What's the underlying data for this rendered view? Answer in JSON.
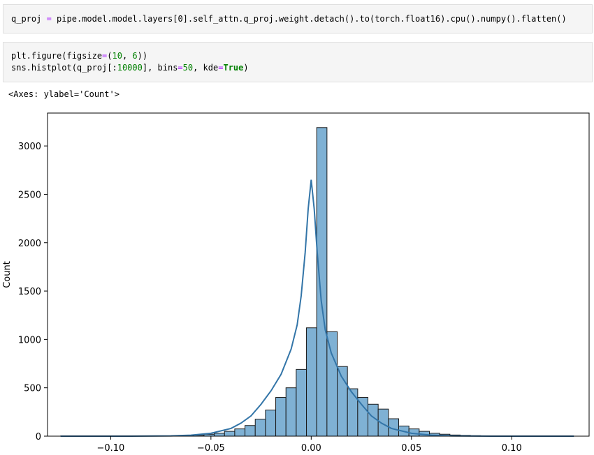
{
  "cells": {
    "code1": {
      "var": "q_proj",
      "eq": " = ",
      "text": "pipe.model.model.layers[0].self_attn.q_proj.weight.detach().to(torch.float16).cpu().numpy().flatten()"
    },
    "code2": {
      "line1_a": "plt.figure(figsize",
      "line1_eq": "=",
      "line1_b": "(",
      "line1_n1": "10",
      "line1_c": ", ",
      "line1_n2": "6",
      "line1_d": "))",
      "line2_a": "sns.histplot(q_proj[:",
      "line2_n1": "10000",
      "line2_b": "], bins",
      "line2_eq1": "=",
      "line2_n2": "50",
      "line2_c": ", kde",
      "line2_eq2": "=",
      "line2_kw": "True",
      "line2_d": ")"
    },
    "output_text": "<Axes: ylabel='Count'>"
  },
  "chart_data": {
    "type": "bar",
    "subtype": "histogram_with_kde",
    "title": "",
    "xlabel": "",
    "ylabel": "Count",
    "xlim": [
      -0.1315,
      0.1386
    ],
    "ylim": [
      0,
      3340
    ],
    "xticks": [
      -0.1,
      -0.05,
      0.0,
      0.05,
      0.1
    ],
    "xtick_labels": [
      "−0.10",
      "−0.05",
      "0.00",
      "0.05",
      "0.10"
    ],
    "yticks": [
      0,
      500,
      1000,
      1500,
      2000,
      2500,
      3000
    ],
    "ytick_labels": [
      "0",
      "500",
      "1000",
      "1500",
      "2000",
      "2500",
      "3000"
    ],
    "bins": 50,
    "bin_start": -0.125,
    "bin_width": 0.00511,
    "counts": [
      1,
      0,
      0,
      0,
      0,
      0,
      1,
      1,
      1,
      2,
      2,
      3,
      6,
      10,
      20,
      30,
      50,
      75,
      110,
      175,
      270,
      400,
      500,
      690,
      1120,
      3190,
      1080,
      720,
      490,
      400,
      330,
      280,
      180,
      105,
      75,
      50,
      30,
      20,
      12,
      8,
      5,
      3,
      2,
      1,
      1,
      0,
      0,
      0,
      0,
      1
    ],
    "kde_x": [
      -0.125,
      -0.09,
      -0.07,
      -0.06,
      -0.05,
      -0.04,
      -0.035,
      -0.03,
      -0.025,
      -0.02,
      -0.015,
      -0.01,
      -0.007,
      -0.005,
      -0.003,
      -0.0015,
      0,
      0.0015,
      0.003,
      0.005,
      0.007,
      0.01,
      0.015,
      0.02,
      0.025,
      0.03,
      0.035,
      0.04,
      0.05,
      0.06,
      0.07,
      0.09,
      0.131
    ],
    "kde_y": [
      0,
      0,
      3,
      10,
      30,
      80,
      135,
      210,
      330,
      470,
      640,
      900,
      1150,
      1450,
      1900,
      2350,
      2650,
      2350,
      1900,
      1400,
      1100,
      860,
      620,
      460,
      330,
      210,
      135,
      80,
      30,
      10,
      3,
      0,
      0
    ],
    "bar_color": "#7fb1d4",
    "bar_edge": "#1a1a1a",
    "line_color": "#3375a8"
  }
}
